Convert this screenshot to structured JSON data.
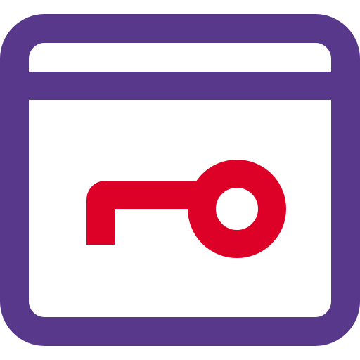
{
  "icon": {
    "name": "browser-window-key-icon",
    "colors": {
      "window_stroke": "#58388a",
      "key_stroke": "#dd0027",
      "background": "#ffffff"
    }
  }
}
